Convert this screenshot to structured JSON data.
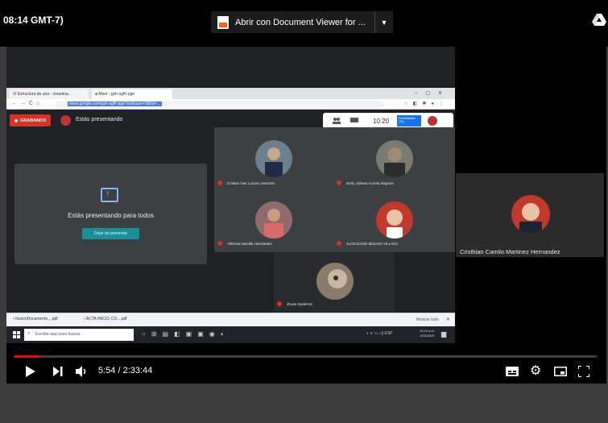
{
  "header": {
    "time_text": "08:14 GMT-7)",
    "open_with_label": "Abrir con Document Viewer for ...",
    "drive_icon": "google-drive-icon"
  },
  "browser": {
    "tabs": [
      {
        "label": "Estructura de una - cmartina..."
      },
      {
        "label": "Meet - gzh-sgfh-pge"
      }
    ],
    "url": "meet.google.com/gzh-sgfh-pge?authuser=2&hs=..."
  },
  "meet": {
    "recording_label": "GRABANDO",
    "presenting_label": "Estás presentando",
    "clock": "10:20",
    "presentation_chip": "Presentación (Tú)",
    "present_card": {
      "title": "Estás presentando para todos",
      "stop_label": "Dejar de presentar"
    },
    "participants": [
      {
        "name": "Cristian Dair Lozano Sanchez",
        "color": "#6b7f8f"
      },
      {
        "name": "Derly Johana Acosta Segovia",
        "color": "#7a7a6e"
      },
      {
        "name": "Yeferson Bonilla Hernández",
        "color": "#8f6b6b"
      },
      {
        "name": "JUAN DAVID MOLINA VILLADA",
        "color": "#c0392b"
      },
      {
        "name": "Jhoan Gutiérrez",
        "color": "#8a7b6a"
      }
    ],
    "side_participant": {
      "name": "Cristhian Camilo Martinez Hernandez",
      "color": "#c0392b"
    }
  },
  "downloads": {
    "items": [
      "NuevoDocumento....pdf",
      "ACTA INICIO CO....pdf"
    ],
    "show_all": "Mostrar todo"
  },
  "taskbar": {
    "search_placeholder": "Escribe aquí para buscar",
    "tray_text": "ESP",
    "clock_time": "10:20 a.m.",
    "clock_date": "4/15/2020"
  },
  "player": {
    "current_time": "5:54",
    "duration": "2:33:44",
    "timecode": "5:54 / 2:33:44",
    "progress_fraction": 0.0425,
    "accent": "#ff0000"
  }
}
